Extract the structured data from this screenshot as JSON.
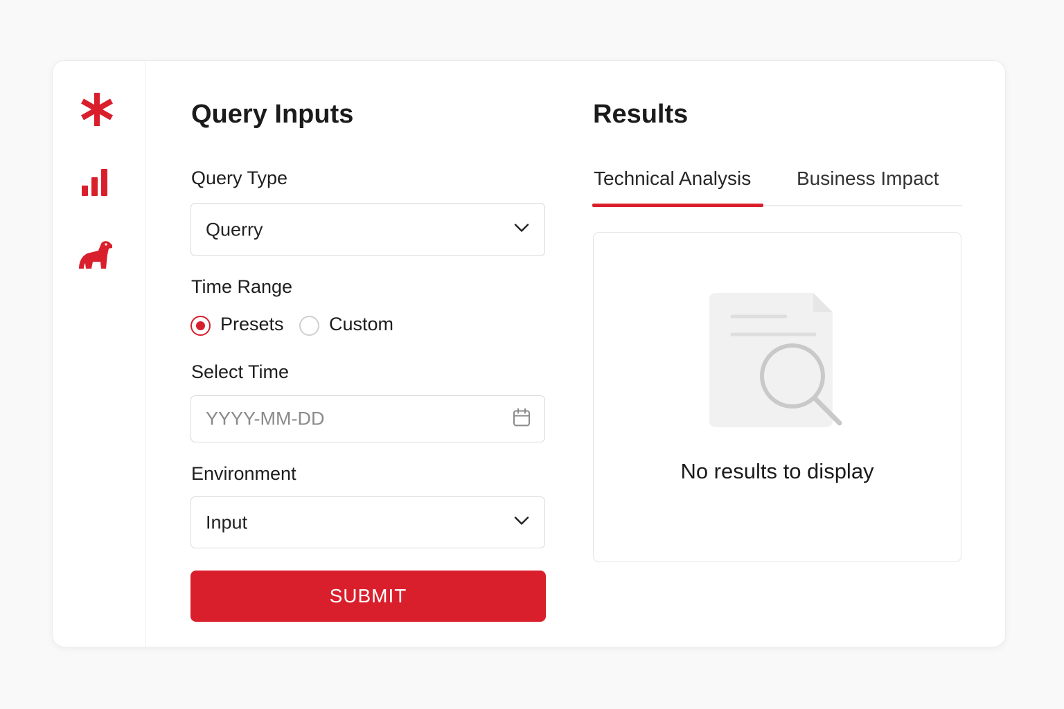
{
  "sidebar": {
    "icons": [
      "asterisk-icon",
      "bar-chart-icon",
      "dog-icon"
    ],
    "accent_color": "#da1f2c"
  },
  "query_inputs": {
    "title": "Query Inputs",
    "query_type": {
      "label": "Query Type",
      "value": "Querry"
    },
    "time_range": {
      "label": "Time Range",
      "options": [
        {
          "label": "Presets",
          "checked": true
        },
        {
          "label": "Custom",
          "checked": false
        }
      ]
    },
    "select_time": {
      "label": "Select Time",
      "placeholder": "YYYY-MM-DD"
    },
    "environment": {
      "label": "Environment",
      "value": "Input"
    },
    "submit_label": "SUBMIT"
  },
  "results": {
    "title": "Results",
    "tabs": [
      {
        "label": "Technical Analysis",
        "active": true
      },
      {
        "label": "Business Impact",
        "active": false
      }
    ],
    "empty_message": "No results to display"
  }
}
